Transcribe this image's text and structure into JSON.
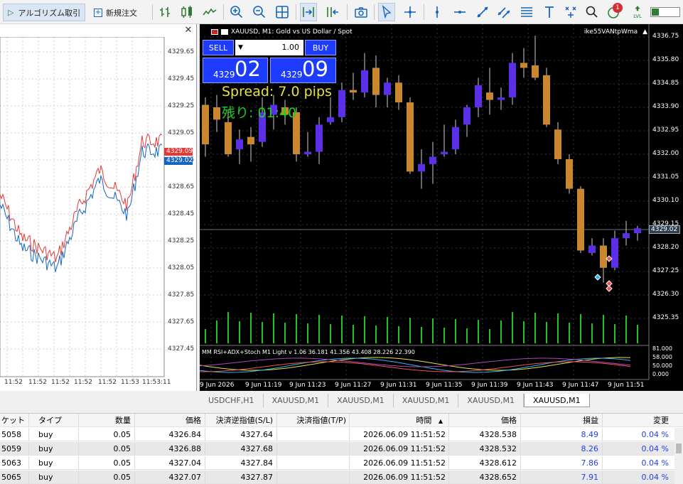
{
  "toolbar": {
    "algo_label": "アルゴリズム取引",
    "new_order_label": "新規注文",
    "notification_count": "1",
    "lvl_label": "LVL"
  },
  "left_chart": {
    "price_ticks": [
      "4329.65",
      "4329.45",
      "4329.25",
      "4329.05",
      "4328.85",
      "4328.65",
      "4328.45",
      "4328.25",
      "4328.05",
      "4327.85",
      "4327.65",
      "4327.45"
    ],
    "time_ticks": [
      "11:52",
      "11:52",
      "11:52",
      "11:52",
      "11:52",
      "11:53",
      "11:53:11"
    ],
    "ask_badge": "4329.09",
    "bid_badge": "4329.02",
    "ask_color": "#e53935",
    "bid_color": "#1565c0"
  },
  "main_chart": {
    "title": "XAUUSD, M1:  Gold vs US Dollar / Spot",
    "account": "ike55VANtpWma",
    "price_ticks": [
      "4336.75",
      "4335.80",
      "4334.85",
      "4333.90",
      "4332.95",
      "4332.00",
      "4331.05",
      "4330.10",
      "4329.15",
      "4328.20",
      "4327.25",
      "4326.30",
      "4325.35"
    ],
    "time_ticks": [
      "9 Jun 2026",
      "9 Jun 11:19",
      "9 Jun 11:23",
      "9 Jun 11:27",
      "9 Jun 11:31",
      "9 Jun 11:35",
      "9 Jun 11:39",
      "9 Jun 11:43",
      "9 Jun 11:47",
      "9 Jun 11:51"
    ],
    "current_price": "4329.02",
    "indicator_label": "MM RSI+ADX+Stoch M1 Light v 1.06 36.181 41.356 43.408 28.226 22.390",
    "indicator_ticks": [
      "81.000",
      "58.000",
      "50.000",
      "0.000"
    ],
    "up_color": "#5b2ee8",
    "down_color": "#c9872f"
  },
  "one_click": {
    "sell_label": "SELL",
    "buy_label": "BUY",
    "lot": "1.00",
    "sell_price_prefix": "4329",
    "sell_price_big": "02",
    "buy_price_prefix": "4329",
    "buy_price_big": "09"
  },
  "overlay": {
    "spread": "Spread: 7.0 pips",
    "remaining": "残り: 01:40"
  },
  "tabs": [
    "USDCHF,H1",
    "XAUUSD,M1",
    "XAUUSD,M1",
    "XAUUSD,M1",
    "XAUUSD,M1",
    "XAUUSD,M1"
  ],
  "trades": {
    "headers": [
      "ケット",
      "タイプ",
      "数量",
      "価格",
      "決済逆指値(S/L)",
      "決済指値(T/P)",
      "時間",
      "価格",
      "損益",
      "変更"
    ],
    "rows": [
      [
        "5058",
        "buy",
        "0.05",
        "4326.84",
        "4327.64",
        "",
        "2026.06.09 11:51:52",
        "4328.538",
        "8.49",
        "0.04 %"
      ],
      [
        "5059",
        "buy",
        "0.05",
        "4326.88",
        "4327.68",
        "",
        "2026.06.09 11:51:52",
        "4328.532",
        "8.26",
        "0.04 %"
      ],
      [
        "5063",
        "buy",
        "0.05",
        "4327.04",
        "4327.84",
        "",
        "2026.06.09 11:51:52",
        "4328.612",
        "7.86",
        "0.04 %"
      ],
      [
        "5065",
        "buy",
        "0.05",
        "4327.07",
        "4327.87",
        "",
        "2026.06.09 11:51:52",
        "4328.652",
        "7.91",
        "0.04 %"
      ]
    ]
  }
}
